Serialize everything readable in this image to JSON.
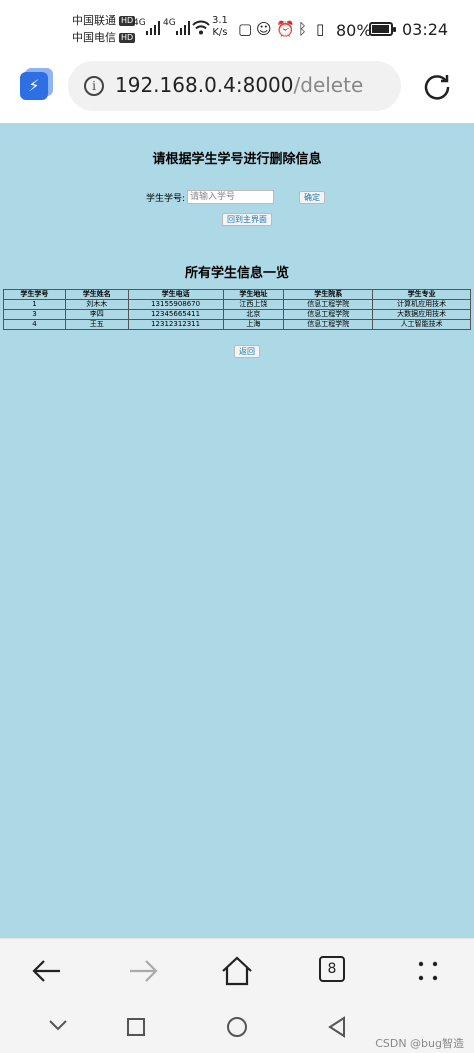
{
  "status": {
    "carrier1": "中国联通",
    "carrier2": "中国电信",
    "hd": "HD",
    "signal1": "4G",
    "signal2": "4G",
    "speed_value": "3.1",
    "speed_unit": "K/s",
    "battery": "80%",
    "time": "03:24"
  },
  "browser": {
    "url_host": "192.168.0.4:8000",
    "url_path": "/delete",
    "tab_count": "8"
  },
  "page": {
    "title": "请根据学生学号进行删除信息",
    "id_label": "学生学号:",
    "id_placeholder": "请输入学号",
    "confirm_label": "确定",
    "home_label": "回到主界面",
    "list_title": "所有学生信息一览",
    "back_label": "返回"
  },
  "table": {
    "headers": [
      "学生学号",
      "学生姓名",
      "学生电话",
      "学生地址",
      "学生院系",
      "学生专业"
    ],
    "rows": [
      [
        "1",
        "刘木木",
        "13155908670",
        "江西上饶",
        "信息工程学院",
        "计算机应用技术"
      ],
      [
        "3",
        "李四",
        "12345665411",
        "北京",
        "信息工程学院",
        "大数据应用技术"
      ],
      [
        "4",
        "王五",
        "12312312311",
        "上海",
        "信息工程学院",
        "人工智能技术"
      ]
    ]
  },
  "watermark": "CSDN @bug智造"
}
